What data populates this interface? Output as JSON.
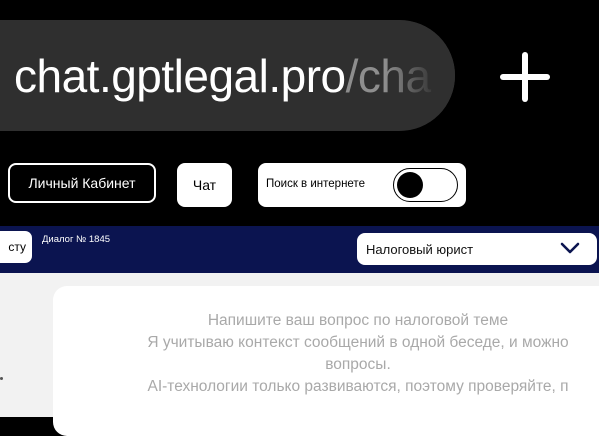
{
  "browser": {
    "url_host": "chat.gptlegal.pro",
    "url_path": "/cha",
    "new_tab_icon": "plus-icon"
  },
  "nav": {
    "cabinet_label": "Личный Кабинет",
    "chat_label": "Чат",
    "web_search_label": "Поиск в интернете",
    "web_search_enabled": false
  },
  "dialog": {
    "back_label": "сту",
    "number_label": "Диалог № 1845",
    "assistant_selected": "Налоговый юрист"
  },
  "main": {
    "hint_line_1": "Напишите ваш вопрос по налоговой теме",
    "hint_line_2": "Я учитываю контекст сообщений в одной беседе, и можно",
    "hint_line_3": "вопросы.",
    "hint_line_4": "AI-технологии только развиваются, поэтому проверяйте, п"
  },
  "colors": {
    "header_blue": "#0b1450",
    "url_bar": "#2f2f2f",
    "hint_text": "#a9a9a9"
  }
}
